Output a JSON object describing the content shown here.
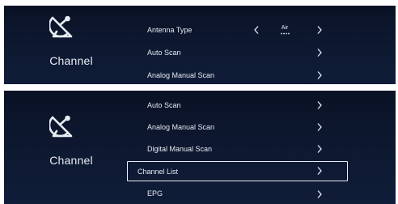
{
  "screens": [
    {
      "side_label": "Channel",
      "icon": "satellite-dish-icon",
      "items": [
        {
          "label": "Antenna Type",
          "value": "Air"
        },
        {
          "label": "Auto Scan"
        },
        {
          "label": "Analog Manual Scan"
        }
      ]
    },
    {
      "side_label": "Channel",
      "icon": "satellite-dish-icon",
      "items": [
        {
          "label": "Auto Scan"
        },
        {
          "label": "Analog Manual Scan"
        },
        {
          "label": "Digital Manual Scan"
        },
        {
          "label": "Channel List",
          "selected": true
        },
        {
          "label": "EPG"
        }
      ]
    }
  ],
  "colors": {
    "panel_bg": "#0d1830",
    "text": "#e6eaf2",
    "highlight_border": "#e8ecf4"
  }
}
